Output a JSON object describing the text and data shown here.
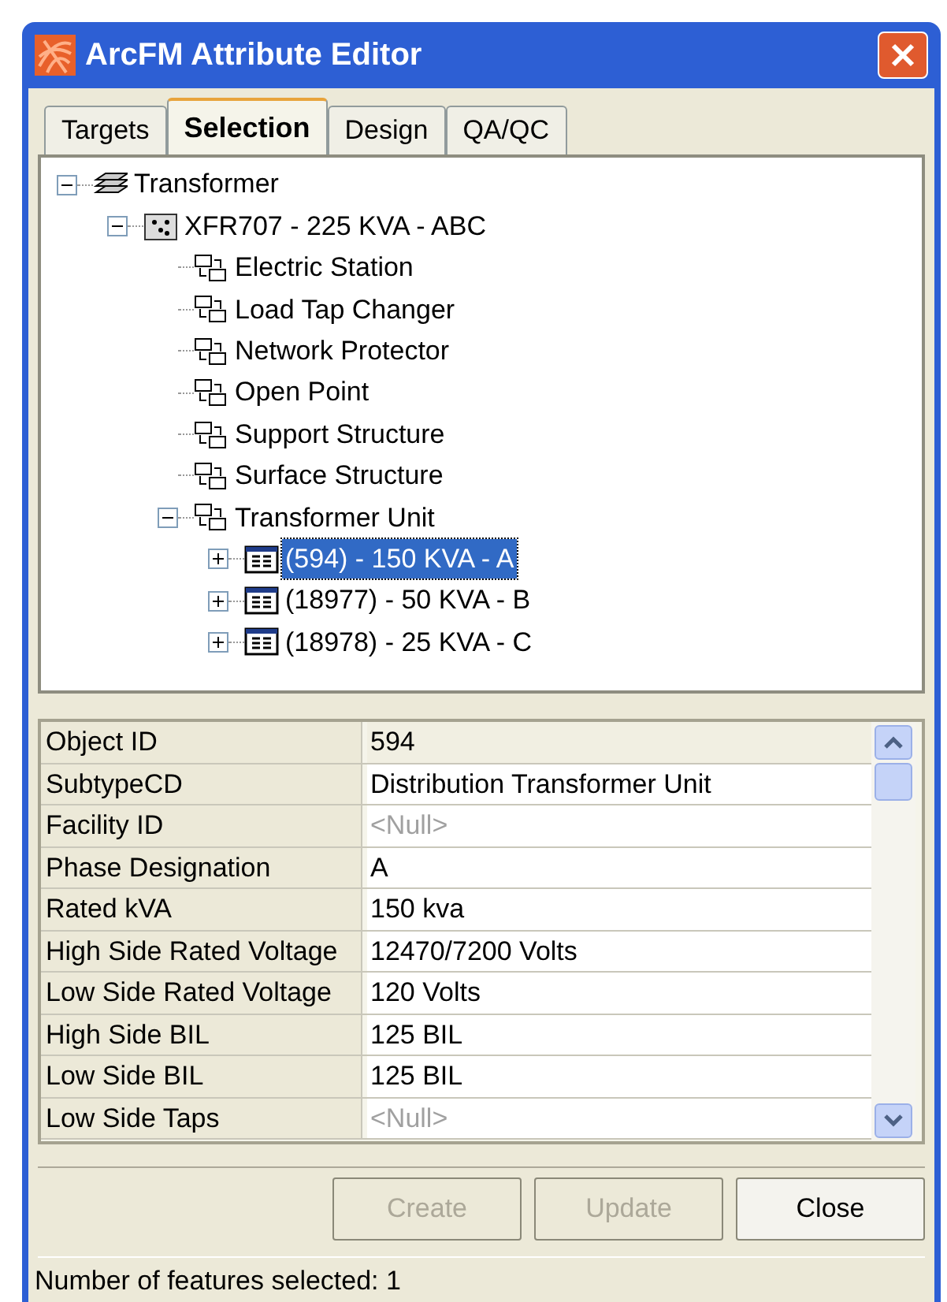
{
  "window": {
    "title": "ArcFM Attribute Editor"
  },
  "tabs": [
    {
      "label": "Targets",
      "selected": false
    },
    {
      "label": "Selection",
      "selected": true
    },
    {
      "label": "Design",
      "selected": false
    },
    {
      "label": "QA/QC",
      "selected": false
    }
  ],
  "tree": [
    {
      "label": "Transformer",
      "kind": "layers",
      "expanded": true,
      "selected": false,
      "children": [
        {
          "label": "XFR707 - 225 KVA - ABC",
          "kind": "feature",
          "expanded": true,
          "selected": false,
          "children": [
            {
              "label": "Electric Station",
              "kind": "relationship",
              "selected": false
            },
            {
              "label": "Load Tap Changer",
              "kind": "relationship",
              "selected": false
            },
            {
              "label": "Network Protector",
              "kind": "relationship",
              "selected": false
            },
            {
              "label": "Open Point",
              "kind": "relationship",
              "selected": false
            },
            {
              "label": "Support Structure",
              "kind": "relationship",
              "selected": false
            },
            {
              "label": "Surface Structure",
              "kind": "relationship",
              "selected": false
            },
            {
              "label": "Transformer Unit",
              "kind": "relationship",
              "expanded": true,
              "selected": false,
              "children": [
                {
                  "label": "(594) - 150 KVA - A",
                  "kind": "table",
                  "expanded": false,
                  "selected": true
                },
                {
                  "label": "(18977) - 50 KVA - B",
                  "kind": "table",
                  "expanded": false,
                  "selected": false
                },
                {
                  "label": "(18978) - 25 KVA - C",
                  "kind": "table",
                  "expanded": false,
                  "selected": false
                }
              ]
            }
          ]
        }
      ]
    }
  ],
  "attributes": [
    {
      "name": "Object ID",
      "value": "594",
      "readonly": true,
      "null": false
    },
    {
      "name": "SubtypeCD",
      "value": "Distribution Transformer Unit",
      "readonly": false,
      "null": false
    },
    {
      "name": "Facility ID",
      "value": "<Null>",
      "readonly": false,
      "null": true
    },
    {
      "name": "Phase Designation",
      "value": "A",
      "readonly": false,
      "null": false
    },
    {
      "name": "Rated kVA",
      "value": "150 kva",
      "readonly": false,
      "null": false
    },
    {
      "name": "High Side Rated Voltage",
      "value": "12470/7200 Volts",
      "readonly": false,
      "null": false
    },
    {
      "name": "Low Side Rated Voltage",
      "value": "120 Volts",
      "readonly": false,
      "null": false
    },
    {
      "name": "High Side BIL",
      "value": "125 BIL",
      "readonly": false,
      "null": false
    },
    {
      "name": "Low Side BIL",
      "value": "125 BIL",
      "readonly": false,
      "null": false
    },
    {
      "name": "Low Side Taps",
      "value": "<Null>",
      "readonly": false,
      "null": true
    }
  ],
  "buttons": [
    {
      "label": "Create",
      "disabled": true
    },
    {
      "label": "Update",
      "disabled": true
    },
    {
      "label": "Close",
      "disabled": false
    }
  ],
  "status_bar": "Number of features selected: 1"
}
